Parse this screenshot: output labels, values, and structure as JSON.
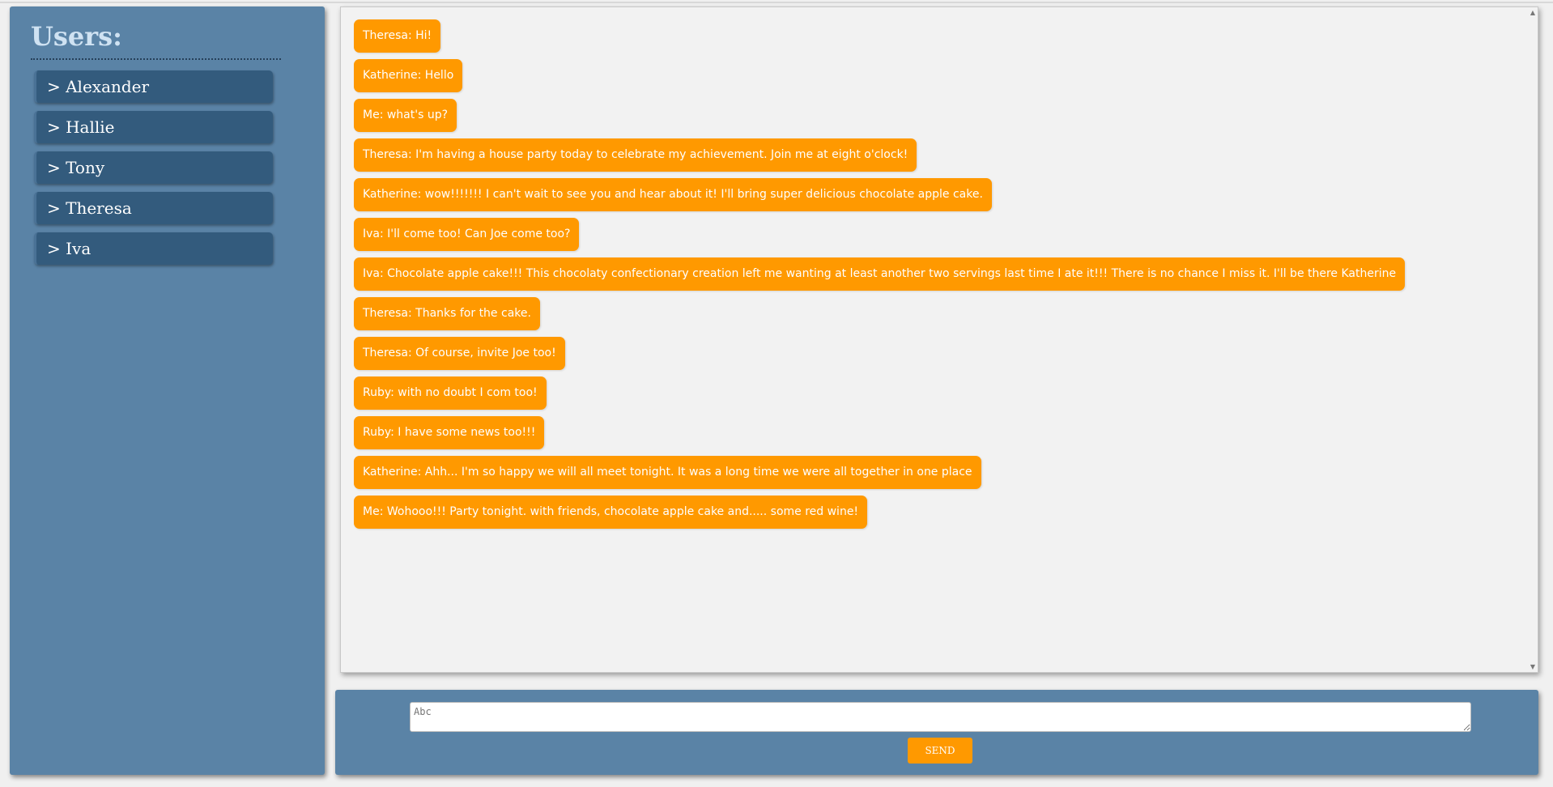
{
  "sidebar": {
    "title": "Users:",
    "users": [
      {
        "label": "> Alexander"
      },
      {
        "label": "> Hallie"
      },
      {
        "label": "> Tony"
      },
      {
        "label": "> Theresa"
      },
      {
        "label": "> Iva"
      }
    ]
  },
  "chat": {
    "messages": [
      {
        "text": "Theresa: Hi!"
      },
      {
        "text": "Katherine: Hello"
      },
      {
        "text": "Me: what's up?"
      },
      {
        "text": "Theresa: I'm having a house party today to celebrate my achievement. Join me at eight o'clock!"
      },
      {
        "text": "Katherine: wow!!!!!!! I can't wait to see you and hear about it! I'll bring super delicious chocolate apple cake."
      },
      {
        "text": "Iva: I'll come too! Can Joe come too?"
      },
      {
        "text": "Iva: Chocolate apple cake!!! This chocolaty confectionary creation left me wanting at least another two servings last time I ate it!!! There is no chance I miss it. I'll be there Katherine"
      },
      {
        "text": "Theresa: Thanks for the cake."
      },
      {
        "text": "Theresa: Of course, invite Joe too!"
      },
      {
        "text": "Ruby: with no doubt I com too!"
      },
      {
        "text": "Ruby: I have some news too!!!"
      },
      {
        "text": "Katherine: Ahh... I'm so happy we will all meet tonight. It was a long time we were all together in one place"
      },
      {
        "text": "Me: Wohooo!!! Party tonight. with friends, chocolate apple cake and..... some red wine!"
      }
    ],
    "scroll_up_glyph": "▲",
    "scroll_down_glyph": "▼"
  },
  "compose": {
    "placeholder": "Abc",
    "value": "",
    "send_label": "SEND"
  },
  "colors": {
    "panel_blue": "#5a83a6",
    "user_item_blue": "#335b7d",
    "accent_orange": "#ff9900",
    "chat_background": "#f2f2f2"
  }
}
